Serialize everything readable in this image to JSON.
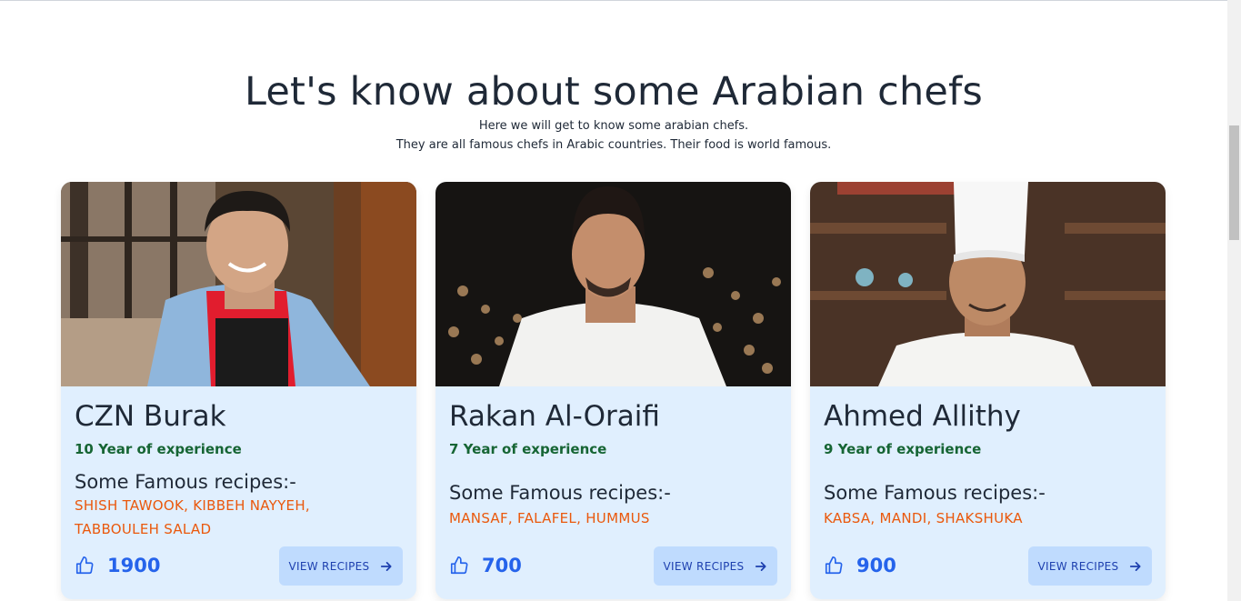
{
  "section": {
    "title": "Let's know about some Arabian chefs",
    "subtitle_line1": "Here we will get to know some arabian chefs.",
    "subtitle_line2": "They are all famous chefs in Arabic countries. Their food is world famous."
  },
  "chefs": [
    {
      "name": "CZN Burak",
      "experience": "10 Year of experience",
      "recipes_heading": "Some Famous recipes:-",
      "recipes": "SHISH TAWOOK, KIBBEH NAYYEH, TABBOULEH SALAD",
      "likes": "1900",
      "button_label": "VIEW RECIPES",
      "icons": {
        "like": "thumbs-up-icon",
        "arrow": "arrow-right-icon"
      }
    },
    {
      "name": "Rakan Al-Oraifi",
      "experience": "7 Year of experience",
      "recipes_heading": "Some Famous recipes:-",
      "recipes": "MANSAF, FALAFEL, HUMMUS",
      "likes": "700",
      "button_label": "VIEW RECIPES",
      "icons": {
        "like": "thumbs-up-icon",
        "arrow": "arrow-right-icon"
      }
    },
    {
      "name": "Ahmed Allithy",
      "experience": "9 Year of experience",
      "recipes_heading": "Some Famous recipes:-",
      "recipes": "KABSA, MANDI, SHAKSHUKA",
      "likes": "900",
      "button_label": "VIEW RECIPES",
      "icons": {
        "like": "thumbs-up-icon",
        "arrow": "arrow-right-icon"
      }
    }
  ],
  "colors": {
    "card_background": "#e0effe",
    "experience_text": "#166534",
    "recipes_text": "#ea580c",
    "likes_text": "#2563eb",
    "button_background": "#bfdbfe"
  }
}
